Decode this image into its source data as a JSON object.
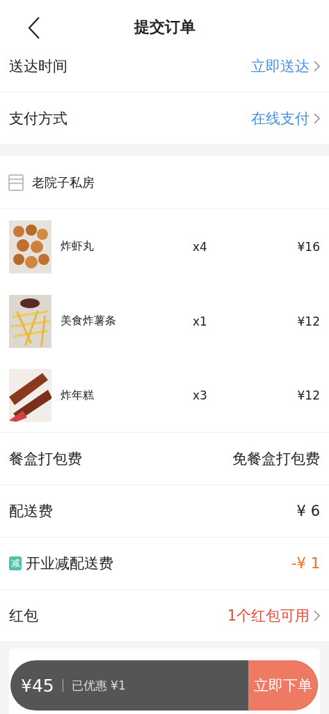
{
  "header": {
    "title": "提交订单"
  },
  "options": [
    {
      "label": "送达时间",
      "value": "立即送达"
    },
    {
      "label": "支付方式",
      "value": "在线支付"
    }
  ],
  "shop": {
    "name": "老院子私房"
  },
  "items": [
    {
      "name": "炸虾丸",
      "quantity": "x4",
      "price": "¥16"
    },
    {
      "name": "美食炸薯条",
      "quantity": "x1",
      "price": "¥12"
    },
    {
      "name": "炸年糕",
      "quantity": "x3",
      "price": "¥12"
    }
  ],
  "charges": [
    {
      "kind": "plain",
      "label": "餐盒打包费",
      "value": "免餐盒打包费"
    },
    {
      "kind": "plain",
      "label": "配送费",
      "value": "¥ 6"
    },
    {
      "kind": "discount",
      "badge": "减",
      "label": "开业减配送费",
      "value": "-¥ 1"
    },
    {
      "kind": "link",
      "label": "红包",
      "value": "1个红包可用"
    }
  ],
  "checkout": {
    "total": "¥45",
    "saved": "已优惠 ¥1",
    "button": "立即下单"
  }
}
